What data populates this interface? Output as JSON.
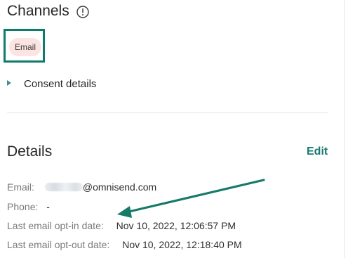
{
  "channels": {
    "title": "Channels",
    "chip_label": "Email",
    "consent_label": "Consent details"
  },
  "details": {
    "title": "Details",
    "edit_label": "Edit",
    "email_label": "Email:",
    "email_domain": "@omnisend.com",
    "phone_label": "Phone:",
    "phone_value": "-",
    "optin_label": "Last email opt-in date:",
    "optin_value": "Nov 10, 2022, 12:06:57 PM",
    "optout_label": "Last email opt-out date:",
    "optout_value": "Nov 10, 2022, 12:18:40 PM"
  },
  "icons": {
    "info": "info-circle-icon",
    "caret": "caret-right-icon",
    "annotation_arrow": "arrow-icon"
  },
  "colors": {
    "accent": "#16796f",
    "highlight_border": "#0f7b6a",
    "chip_background": "#fbe4e2",
    "caret": "#3f8f93"
  }
}
